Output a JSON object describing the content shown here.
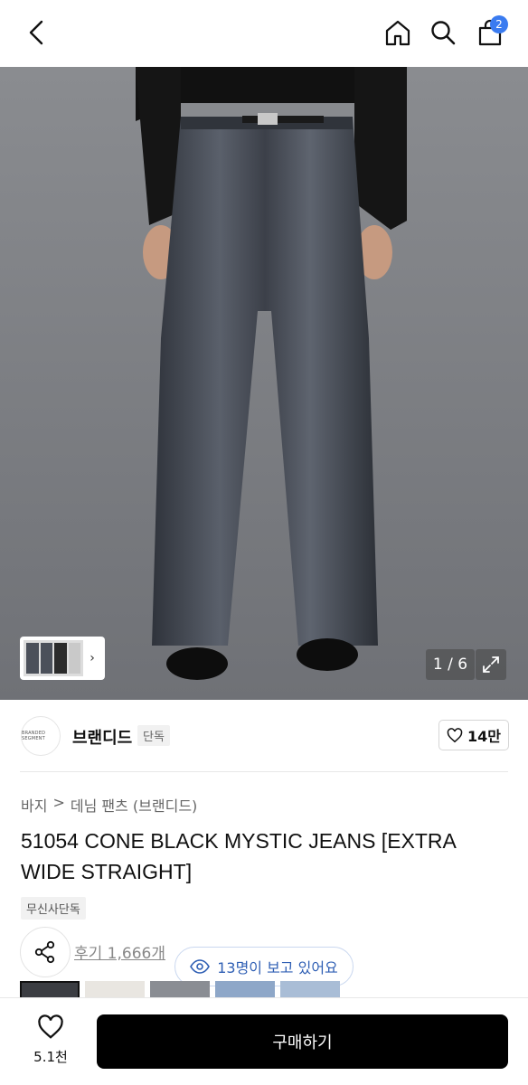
{
  "header": {
    "cart_count": "2",
    "icons": [
      "back-icon",
      "home-icon",
      "search-icon",
      "cart-icon"
    ]
  },
  "gallery": {
    "counter": "1 / 6"
  },
  "brand": {
    "logo_text": "BRANDED SEGMENT",
    "name": "브랜디드",
    "tag": "단독",
    "likes": "14만"
  },
  "breadcrumb": {
    "category": "바지",
    "separator": ">",
    "subcategory": "데님 팬츠 (브랜디드)"
  },
  "product": {
    "title": "51054 CONE BLACK MYSTIC JEANS [EXTRA WIDE STRAIGHT]",
    "exclusive_badge": "무신사단독",
    "reviews": "후기 1,666개",
    "viewers": "13명이 보고 있어요"
  },
  "bottom": {
    "wish_count": "5.1천",
    "buy_label": "구매하기"
  },
  "colors": {
    "accent": "#3a7bf0",
    "viewers_text": "#2f5fb4"
  }
}
